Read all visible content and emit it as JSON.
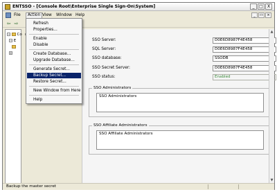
{
  "window": {
    "title": "ENTSSO - [Console Root\\Enterprise Single Sign-On\\System]",
    "buttons": {
      "minimize": "_",
      "maximize": "□",
      "close": "X"
    }
  },
  "menubar": {
    "items": [
      "File",
      "Action",
      "View",
      "Window",
      "Help"
    ],
    "inner_buttons": {
      "minimize": "_",
      "restore": "▭",
      "close": "×"
    }
  },
  "toolbar": {
    "back": "⇦",
    "forward": "⇨"
  },
  "tree": {
    "rows": [
      {
        "label": "Conso"
      },
      {
        "label": "E"
      }
    ]
  },
  "action_menu": {
    "items": [
      {
        "label": "Refresh"
      },
      {
        "label": "Properties..."
      },
      {
        "label": "Enable"
      },
      {
        "label": "Disable"
      },
      {
        "label": "Create Database..."
      },
      {
        "label": "Upgrade Database..."
      },
      {
        "label": "Generate Secret..."
      },
      {
        "label": "Backup Secret..."
      },
      {
        "label": "Restore Secret..."
      },
      {
        "label": "New Window from Here"
      },
      {
        "label": "Help"
      }
    ]
  },
  "details": {
    "fields": [
      {
        "label": "SSO Server:",
        "value": "D0E6D8987F4E458"
      },
      {
        "label": "SQL Server:",
        "value": "D0E6D8987F4E458"
      },
      {
        "label": "SSO database:",
        "value": "SSODB"
      },
      {
        "label": "SSO Secret Server:",
        "value": "D0E6D8987F4E458"
      },
      {
        "label": "SSO status:",
        "value": "Enabled"
      }
    ],
    "groups": [
      {
        "title": "SSO Administrators",
        "value": "SSO Administrators"
      },
      {
        "title": "SSO Affiliate Administrators",
        "value": "SSO Affiliate Administrators"
      }
    ]
  },
  "scrollbar": {
    "up": "▲",
    "down": "▼"
  },
  "statusbar": {
    "text": "Backup the master secret"
  },
  "colors": {
    "menu_highlight": "#0a246a",
    "status_enabled": "#3c8a3c"
  }
}
